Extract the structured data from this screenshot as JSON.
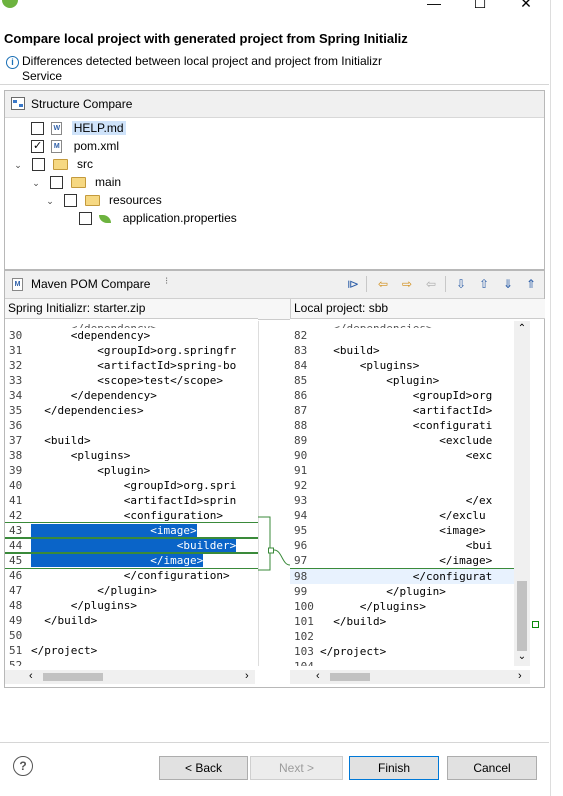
{
  "window": {
    "minimize_label": "—",
    "maximize_label": "☐",
    "close_label": "✕"
  },
  "header": {
    "title": "Compare local project with generated project from Spring Initializ",
    "description": "Differences detected between local project and project from Initializr Service"
  },
  "structure_compare": {
    "title": "Structure Compare",
    "items": [
      {
        "label": "HELP.md",
        "checked": false
      },
      {
        "label": "pom.xml",
        "checked": true
      },
      {
        "label": "src",
        "checked": false
      },
      {
        "label": "main",
        "checked": false
      },
      {
        "label": "resources",
        "checked": false
      },
      {
        "label": "application.properties",
        "checked": false
      }
    ]
  },
  "maven_compare": {
    "title": "Maven POM Compare",
    "left_title": "Spring Initializr: starter.zip",
    "right_title": "Local project: sbb",
    "left_lines": [
      {
        "n": "30",
        "t": "      <dependency>"
      },
      {
        "n": "31",
        "t": "          <groupId>org.springfr"
      },
      {
        "n": "32",
        "t": "          <artifactId>spring-bo"
      },
      {
        "n": "33",
        "t": "          <scope>test</scope>"
      },
      {
        "n": "34",
        "t": "      </dependency>"
      },
      {
        "n": "35",
        "t": "  </dependencies>"
      },
      {
        "n": "36",
        "t": ""
      },
      {
        "n": "37",
        "t": "  <build>"
      },
      {
        "n": "38",
        "t": "      <plugins>"
      },
      {
        "n": "39",
        "t": "          <plugin>"
      },
      {
        "n": "40",
        "t": "              <groupId>org.spri"
      },
      {
        "n": "41",
        "t": "              <artifactId>sprin"
      },
      {
        "n": "42",
        "t": "              <configuration>"
      },
      {
        "n": "43",
        "t": "                  <image>"
      },
      {
        "n": "44",
        "t": "                      <builder>"
      },
      {
        "n": "45",
        "t": "                  </image>"
      },
      {
        "n": "46",
        "t": "              </configuration>"
      },
      {
        "n": "47",
        "t": "          </plugin>"
      },
      {
        "n": "48",
        "t": "      </plugins>"
      },
      {
        "n": "49",
        "t": "  </build>"
      },
      {
        "n": "50",
        "t": ""
      },
      {
        "n": "51",
        "t": "</project>"
      },
      {
        "n": "52",
        "t": ""
      }
    ],
    "right_lines": [
      {
        "n": "82",
        "t": ""
      },
      {
        "n": "83",
        "t": "  <build>"
      },
      {
        "n": "84",
        "t": "      <plugins>"
      },
      {
        "n": "85",
        "t": "          <plugin>"
      },
      {
        "n": "86",
        "t": "              <groupId>org"
      },
      {
        "n": "87",
        "t": "              <artifactId>"
      },
      {
        "n": "88",
        "t": "              <configurati"
      },
      {
        "n": "89",
        "t": "                  <exclude"
      },
      {
        "n": "90",
        "t": "                      <exc"
      },
      {
        "n": "91",
        "t": ""
      },
      {
        "n": "92",
        "t": ""
      },
      {
        "n": "93",
        "t": "                      </ex"
      },
      {
        "n": "94",
        "t": "                  </exclu"
      },
      {
        "n": "95",
        "t": "                  <image>"
      },
      {
        "n": "96",
        "t": "                      <bui"
      },
      {
        "n": "97",
        "t": "                  </image>"
      },
      {
        "n": "98",
        "t": "              </configurat"
      },
      {
        "n": "99",
        "t": "          </plugin>"
      },
      {
        "n": "100",
        "t": "      </plugins>"
      },
      {
        "n": "101",
        "t": "  </build>"
      },
      {
        "n": "102",
        "t": ""
      },
      {
        "n": "103",
        "t": "</project>"
      },
      {
        "n": "104",
        "t": ""
      }
    ]
  },
  "buttons": {
    "back": "< Back",
    "next": "Next >",
    "finish": "Finish",
    "cancel": "Cancel"
  },
  "colors": {
    "selection": "#0a64c8",
    "diff_connector": "#3a8a3a",
    "current_line": "#e8f2fe"
  }
}
